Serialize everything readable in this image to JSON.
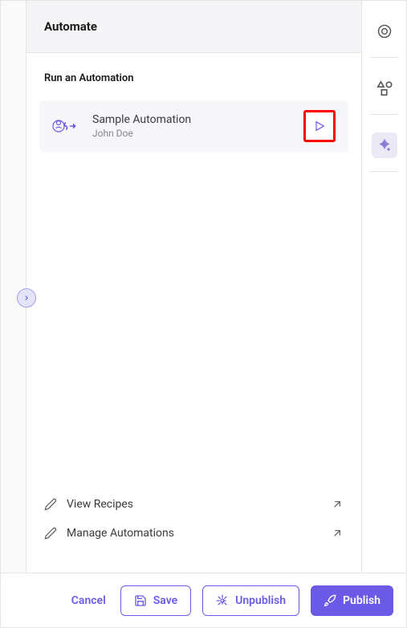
{
  "panel": {
    "title": "Automate",
    "section_title": "Run an Automation",
    "automation": {
      "name": "Sample Automation",
      "author": "John Doe"
    },
    "footer_links": {
      "view_recipes": "View Recipes",
      "manage_automations": "Manage Automations"
    }
  },
  "bottom_bar": {
    "cancel": "Cancel",
    "save": "Save",
    "unpublish": "Unpublish",
    "publish": "Publish"
  },
  "colors": {
    "primary": "#6b5ae6",
    "highlight": "#ff0000"
  }
}
